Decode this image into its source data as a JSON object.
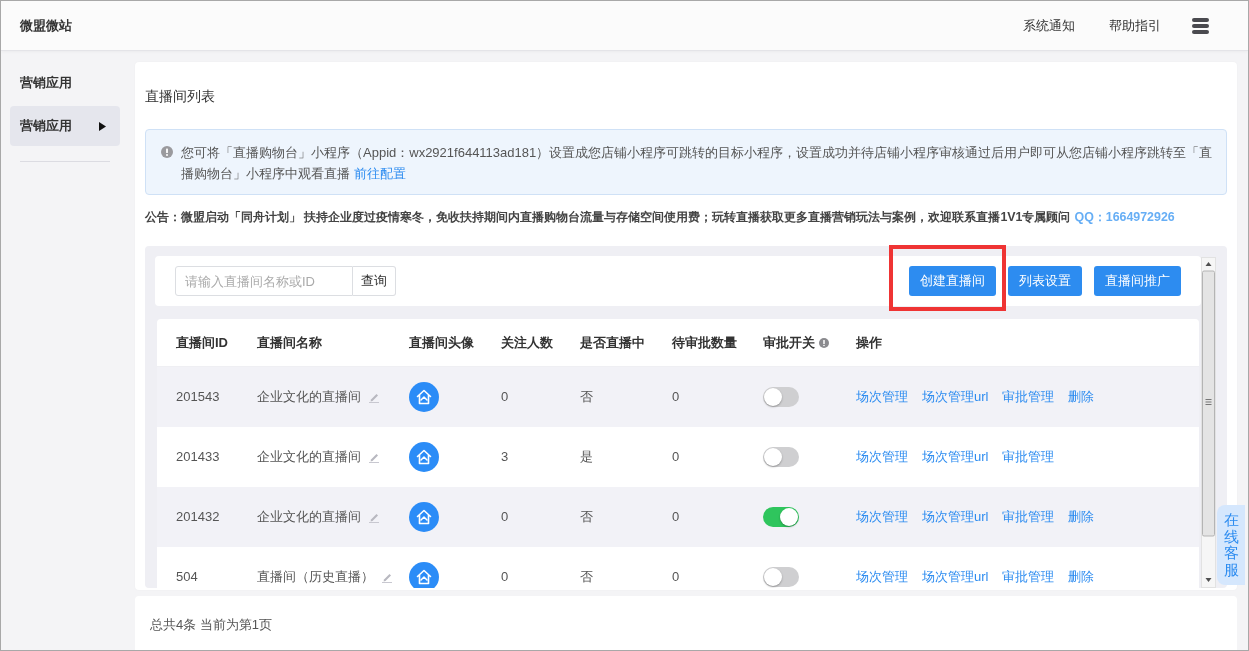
{
  "header": {
    "brand": "微盟微站",
    "links": [
      "系统通知",
      "帮助指引"
    ]
  },
  "sidebar": {
    "heading": "营销应用",
    "items": [
      {
        "label": "营销应用",
        "selected": true
      }
    ]
  },
  "page_title": "直播间列表",
  "notice": {
    "text": "您可将「直播购物台」小程序（Appid：wx2921f644113ad181）设置成您店铺小程序可跳转的目标小程序，设置成功并待店铺小程序审核通过后用户即可从您店铺小程序跳转至「直播购物台」小程序中观看直播",
    "link": "前往配置"
  },
  "announcement": {
    "text": "公告：微盟启动「同舟计划」 扶持企业度过疫情寒冬，免收扶持期间内直播购物台流量与存储空间使用费；玩转直播获取更多直播营销玩法与案例，欢迎联系直播1V1专属顾问",
    "contact": "QQ：1664972926"
  },
  "toolbar": {
    "search": {
      "placeholder": "请输入直播间名称或ID"
    },
    "search_button": "查询",
    "buttons": [
      {
        "label": "创建直播间",
        "highlighted": true
      },
      {
        "label": "列表设置",
        "highlighted": false
      },
      {
        "label": "直播间推广",
        "highlighted": false
      }
    ]
  },
  "table": {
    "columns": [
      {
        "label": "直播间ID",
        "info": false
      },
      {
        "label": "直播间名称",
        "info": false
      },
      {
        "label": "直播间头像",
        "info": false
      },
      {
        "label": "关注人数",
        "info": false
      },
      {
        "label": "是否直播中",
        "info": false
      },
      {
        "label": "待审批数量",
        "info": false
      },
      {
        "label": "审批开关",
        "info": true
      },
      {
        "label": "操作",
        "info": false
      }
    ],
    "rows": [
      {
        "id": "201543",
        "name": "企业文化的直播间",
        "followers": "0",
        "live": "否",
        "pending": "0",
        "approval_on": false,
        "actions": [
          "场次管理",
          "场次管理url",
          "审批管理",
          "删除"
        ]
      },
      {
        "id": "201433",
        "name": "企业文化的直播间",
        "followers": "3",
        "live": "是",
        "pending": "0",
        "approval_on": false,
        "actions": [
          "场次管理",
          "场次管理url",
          "审批管理"
        ]
      },
      {
        "id": "201432",
        "name": "企业文化的直播间",
        "followers": "0",
        "live": "否",
        "pending": "0",
        "approval_on": true,
        "actions": [
          "场次管理",
          "场次管理url",
          "审批管理",
          "删除"
        ]
      },
      {
        "id": "504",
        "name": "直播间（历史直播）",
        "followers": "0",
        "live": "否",
        "pending": "0",
        "approval_on": false,
        "actions": [
          "场次管理",
          "场次管理url",
          "审批管理",
          "删除"
        ]
      }
    ]
  },
  "footer": {
    "summary": "总共4条 当前为第1页"
  },
  "support_tab": {
    "label": "在线客服"
  }
}
